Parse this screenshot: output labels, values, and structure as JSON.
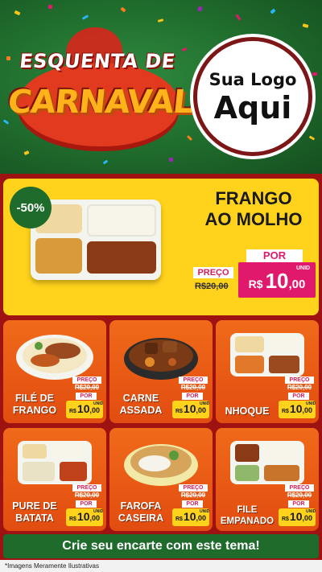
{
  "header": {
    "title_line1": "ESQUENTA DE",
    "title_line2": "CARNAVAL",
    "logo_line1": "Sua Logo",
    "logo_line2": "Aqui"
  },
  "feature": {
    "discount": "-50%",
    "name_line1": "FRANGO",
    "name_line2": "AO MOLHO",
    "preco_label": "PREÇO",
    "old_price": "R$20,00",
    "por_label": "POR",
    "currency": "R$",
    "price_int": "10",
    "price_cents": ",00",
    "unid": "UNID"
  },
  "products": [
    {
      "name_line1": "FILÉ DE",
      "name_line2": "FRANGO",
      "preco_label": "PREÇO",
      "old_price": "R$20,00",
      "por_label": "POR",
      "currency": "R$",
      "price_int": "10",
      "price_cents": ",00",
      "unid": "UNID"
    },
    {
      "name_line1": "CARNE",
      "name_line2": "ASSADA",
      "preco_label": "PREÇO",
      "old_price": "R$20,00",
      "por_label": "POR",
      "currency": "R$",
      "price_int": "10",
      "price_cents": ",00",
      "unid": "UNID"
    },
    {
      "name_line1": "NHOQUE",
      "name_line2": "",
      "preco_label": "PREÇO",
      "old_price": "R$20,00",
      "por_label": "POR",
      "currency": "R$",
      "price_int": "10",
      "price_cents": ",00",
      "unid": "UNID"
    },
    {
      "name_line1": "PURE DE",
      "name_line2": "BATATA",
      "preco_label": "PREÇO",
      "old_price": "R$20,00",
      "por_label": "POR",
      "currency": "R$",
      "price_int": "10",
      "price_cents": ",00",
      "unid": "UNID"
    },
    {
      "name_line1": "FAROFA",
      "name_line2": "CASEIRA",
      "preco_label": "PREÇO",
      "old_price": "R$20,00",
      "por_label": "POR",
      "currency": "R$",
      "price_int": "10",
      "price_cents": ",00",
      "unid": "UNID"
    },
    {
      "name_line1": "FILE",
      "name_line2": "EMPANADO",
      "preco_label": "PREÇO",
      "old_price": "R$20,00",
      "por_label": "POR",
      "currency": "R$",
      "price_int": "10",
      "price_cents": ",00",
      "unid": "UNID"
    }
  ],
  "footer": {
    "cta": "Crie seu encarte com este tema!",
    "disclaimer": "*Imagens Meramente Ilustrativas"
  },
  "colors": {
    "background": "#9e1212",
    "header_green": "#1f6b2c",
    "feature_yellow": "#ffd21c",
    "card_orange": "#f06a1a",
    "price_pink": "#e0196c"
  }
}
